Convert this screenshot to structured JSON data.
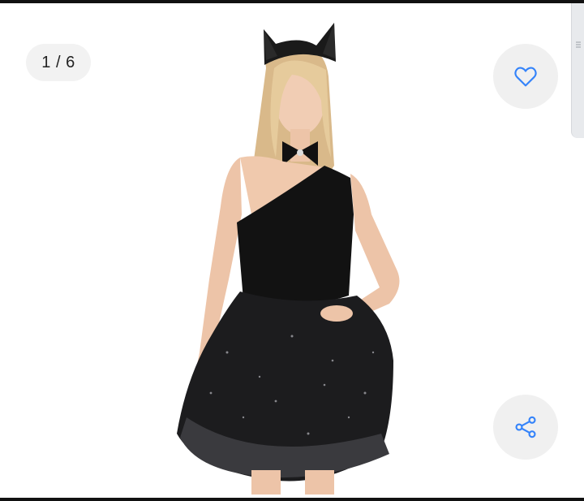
{
  "gallery": {
    "counter": "1 / 6"
  },
  "icons": {
    "favorite": "heart-icon",
    "share": "share-icon"
  },
  "colors": {
    "accent": "#3483fa",
    "button_bg": "#f0f0f0"
  }
}
